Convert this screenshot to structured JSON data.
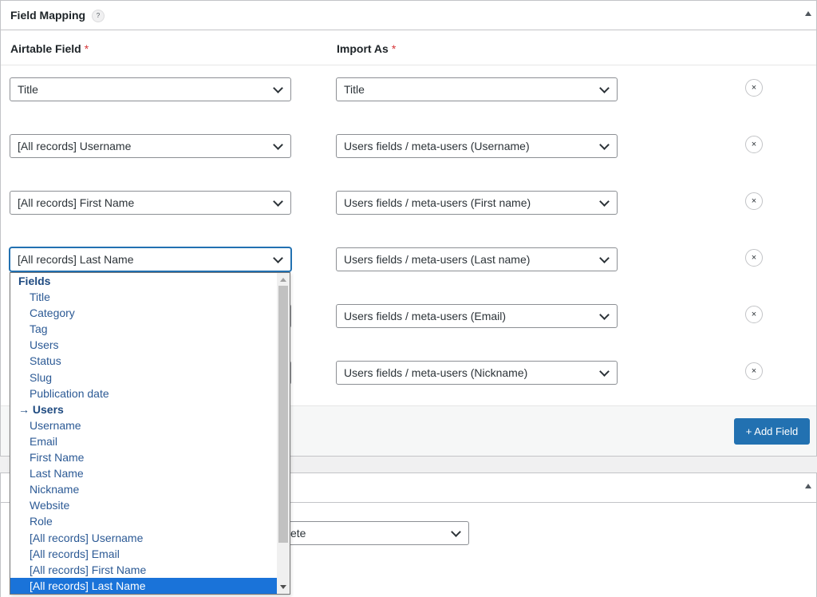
{
  "panel": {
    "title": "Field Mapping",
    "help": "?",
    "col_airtable": "Airtable Field",
    "col_import": "Import As",
    "required_mark": "*"
  },
  "rows": [
    {
      "airtable": "Title",
      "import_as": "Title"
    },
    {
      "airtable": "[All records] Username",
      "import_as": "Users fields / meta-users (Username)"
    },
    {
      "airtable": "[All records] First Name",
      "import_as": "Users fields / meta-users (First name)"
    },
    {
      "airtable": "[All records] Last Name",
      "import_as": "Users fields / meta-users (Last name)"
    },
    {
      "airtable": "",
      "import_as": "Users fields / meta-users (Email)"
    },
    {
      "airtable": "",
      "import_as": "Users fields / meta-users (Nickname)"
    }
  ],
  "remove_label": "×",
  "add_field_label": "+ Add Field",
  "panel2": {
    "select_value": "ete"
  },
  "dropdown": {
    "items": [
      {
        "label": "Fields",
        "group": true
      },
      {
        "label": "Title"
      },
      {
        "label": "Category"
      },
      {
        "label": "Tag"
      },
      {
        "label": "Users"
      },
      {
        "label": "Status"
      },
      {
        "label": "Slug"
      },
      {
        "label": "Publication date"
      },
      {
        "label": "→ Users",
        "group": true
      },
      {
        "label": "Username"
      },
      {
        "label": "Email"
      },
      {
        "label": "First Name"
      },
      {
        "label": "Last Name"
      },
      {
        "label": "Nickname"
      },
      {
        "label": "Website"
      },
      {
        "label": "Role"
      },
      {
        "label": "[All records] Username"
      },
      {
        "label": "[All records] Email"
      },
      {
        "label": "[All records] First Name"
      },
      {
        "label": "[All records] Last Name",
        "selected": true
      }
    ]
  },
  "colors": {
    "primary": "#2271b1",
    "required": "#d63638",
    "selected_option": "#1a73d9"
  }
}
